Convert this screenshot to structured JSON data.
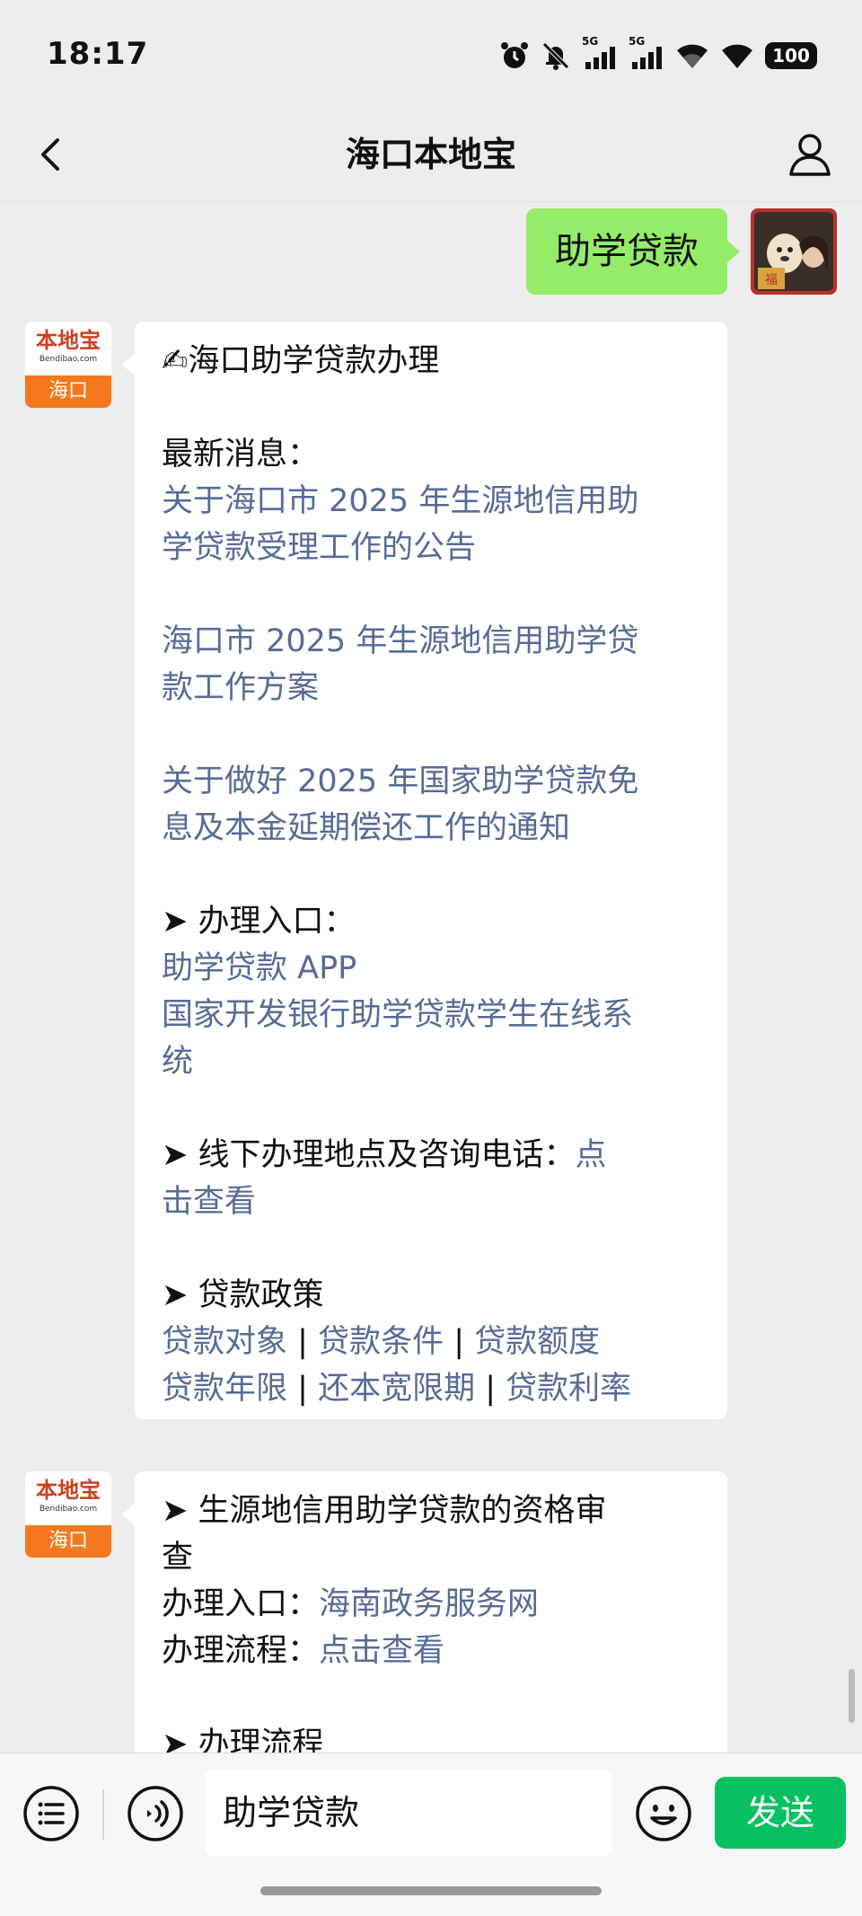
{
  "status_bar": {
    "time": "18:17",
    "signal1_label": "5G",
    "signal2_label": "5G",
    "battery": "100",
    "icons": [
      "alarm-icon",
      "mute-icon",
      "signal-icon",
      "signal-icon",
      "wifi-icon",
      "wifi-icon",
      "battery-icon"
    ]
  },
  "nav": {
    "title": "海口本地宝",
    "back_icon": "chevron-left-icon",
    "profile_icon": "person-icon"
  },
  "user_message": {
    "text": "助学贷款"
  },
  "bot": {
    "logo_cn": "本地宝",
    "logo_en": "Bendibao.com",
    "logo_city": "海口"
  },
  "bot_message_1": {
    "title": "✍海口助学贷款办理",
    "latest_label": "最新消息：",
    "news": [
      {
        "line1": "关于海口市 2025 年生源地信用助",
        "line2": "学贷款受理工作的公告"
      },
      {
        "line1": "海口市 2025 年生源地信用助学贷",
        "line2": "款工作方案"
      },
      {
        "line1": "关于做好 2025 年国家助学贷款免",
        "line2": "息及本金延期偿还工作的通知"
      }
    ],
    "entry_label": "➤ 办理入口：",
    "entry_app": "助学贷款 APP",
    "entry_system_line1": "国家开发银行助学贷款学生在线系",
    "entry_system_line2": "统",
    "offline_label": "➤ 线下办理地点及咨询电话：",
    "offline_link_part1": "点",
    "offline_link_part2": "击查看",
    "policy_label": "➤ 贷款政策",
    "policy_row1": [
      "贷款对象",
      "贷款条件",
      "贷款额度"
    ],
    "policy_row2": [
      "贷款年限",
      "还本宽限期",
      "贷款利率"
    ],
    "separator": " | "
  },
  "bot_message_2": {
    "heading_line1": "➤ 生源地信用助学贷款的资格审",
    "heading_line2": "查",
    "entry_label": "办理入口：",
    "entry_link": "海南政务服务网",
    "process_label": "办理流程：",
    "process_link": "点击查看",
    "next_heading": "➤ 办理流程"
  },
  "input_bar": {
    "menu_icon": "list-menu-icon",
    "voice_icon": "voice-icon",
    "input_value": "助学贷款",
    "emoji_icon": "emoji-icon",
    "send_label": "发送"
  },
  "colors": {
    "background": "#ededed",
    "user_bubble": "#95ec69",
    "link": "#576b95",
    "send_button": "#07c160",
    "bot_logo_orange": "#f5771e"
  }
}
